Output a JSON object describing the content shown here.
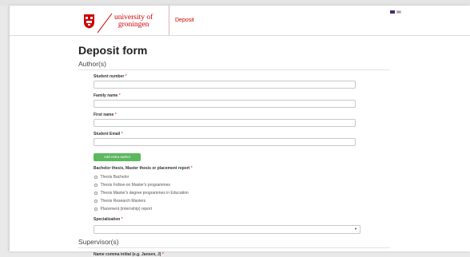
{
  "header": {
    "logo_line1": "university of",
    "logo_line2": "groningen",
    "nav_deposit": "Deposit",
    "language_flags": [
      "uk-flag-icon",
      "nl-flag-icon"
    ]
  },
  "form": {
    "title": "Deposit form",
    "authors_section": "Author(s)",
    "student_number_label": "Student number",
    "family_name_label": "Family name",
    "first_name_label": "First name",
    "student_email_label": "Student Email",
    "required_marker": "*",
    "add_author_button": "Add extra author",
    "thesis_type_label": "Bachelor thesis, Master thesis or placement report",
    "thesis_options": [
      "Thesis Bachelor",
      "Thesis Follow-on Master's programmes",
      "Thesis Master's degree programmes in Education",
      "Thesis Research Masters",
      "Placement (internship) report"
    ],
    "specialization_label": "Specialization",
    "specialization_value": "",
    "supervisors_section": "Supervisor(s)",
    "supervisor_name_label": "Name comma initial (e.g. Jansen, J)"
  },
  "colors": {
    "brand_red": "#cc0000",
    "button_green": "#5cb85c"
  }
}
